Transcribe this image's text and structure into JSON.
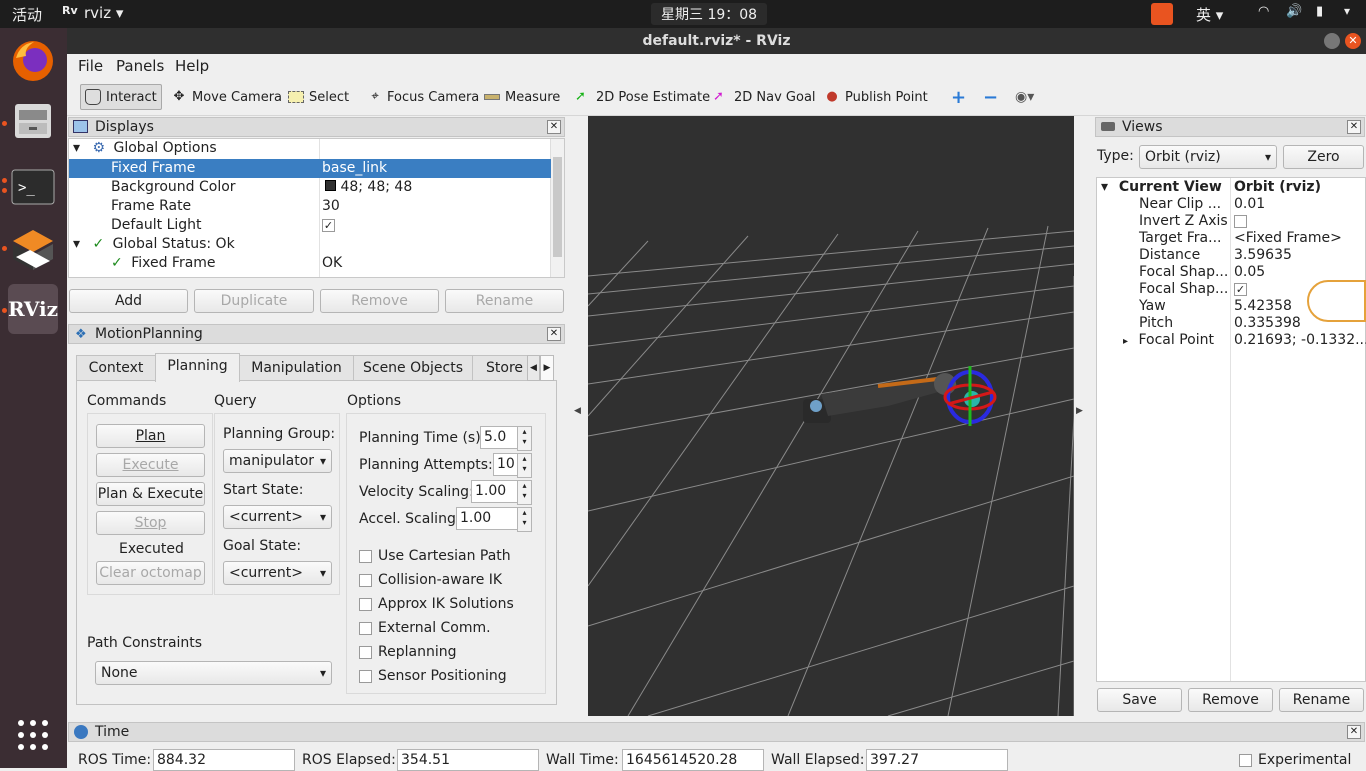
{
  "topbar": {
    "activities": "活动",
    "app_name": "rviz",
    "clock": "星期三 19：08",
    "ime": "英"
  },
  "window": {
    "title": "default.rviz* - RViz"
  },
  "menu": {
    "file": "File",
    "panels": "Panels",
    "help": "Help"
  },
  "toolbar": {
    "interact": "Interact",
    "move_camera": "Move Camera",
    "select": "Select",
    "focus_camera": "Focus Camera",
    "measure": "Measure",
    "pose_estimate": "2D Pose Estimate",
    "nav_goal": "2D Nav Goal",
    "publish_point": "Publish Point"
  },
  "displays": {
    "title": "Displays",
    "global_options": "Global Options",
    "fixed_frame_label": "Fixed Frame",
    "fixed_frame_value": "base_link",
    "bg_color_label": "Background Color",
    "bg_color_value": "48; 48; 48",
    "frame_rate_label": "Frame Rate",
    "frame_rate_value": "30",
    "default_light_label": "Default Light",
    "global_status": "Global Status: Ok",
    "status_fixed_frame": "Fixed Frame",
    "status_fixed_frame_value": "OK",
    "add": "Add",
    "duplicate": "Duplicate",
    "remove": "Remove",
    "rename": "Rename"
  },
  "motion": {
    "title": "MotionPlanning",
    "tabs": [
      "Context",
      "Planning",
      "Manipulation",
      "Scene Objects",
      "Store"
    ],
    "commands": "Commands",
    "query": "Query",
    "options": "Options",
    "plan": "Plan",
    "execute": "Execute",
    "plan_execute": "Plan & Execute",
    "stop": "Stop",
    "executed": "Executed",
    "clear_octomap": "Clear octomap",
    "planning_group_label": "Planning Group:",
    "planning_group": "manipulator",
    "start_state_label": "Start State:",
    "start_state": "<current>",
    "goal_state_label": "Goal State:",
    "goal_state": "<current>",
    "planning_time_label": "Planning Time (s):",
    "planning_time": "5.0",
    "planning_attempts_label": "Planning Attempts:",
    "planning_attempts": "10",
    "velocity_label": "Velocity Scaling:",
    "velocity": "1.00",
    "accel_label": "Accel. Scaling:",
    "accel": "1.00",
    "checks": [
      "Use Cartesian Path",
      "Collision-aware IK",
      "Approx IK Solutions",
      "External Comm.",
      "Replanning",
      "Sensor Positioning"
    ],
    "path_constraints_label": "Path Constraints",
    "path_constraints": "None"
  },
  "views": {
    "title": "Views",
    "type_label": "Type:",
    "type_value": "Orbit (rviz)",
    "zero": "Zero",
    "current_view": "Current View",
    "current_view_value": "Orbit (rviz)",
    "near_clip": "Near Clip ...",
    "near_clip_value": "0.01",
    "invert_z": "Invert Z Axis",
    "target_frame": "Target Fra...",
    "target_frame_value": "<Fixed Frame>",
    "distance": "Distance",
    "distance_value": "3.59635",
    "focal_shape1": "Focal Shap...",
    "focal_shape1_value": "0.05",
    "focal_shape2": "Focal Shap...",
    "yaw": "Yaw",
    "yaw_value": "5.42358",
    "pitch": "Pitch",
    "pitch_value": "0.335398",
    "focal_point": "Focal Point",
    "focal_point_value": "0.21693; -0.1332...",
    "save": "Save",
    "remove": "Remove",
    "rename": "Rename"
  },
  "time": {
    "title": "Time",
    "ros_time_label": "ROS Time:",
    "ros_time": "884.32",
    "ros_elapsed_label": "ROS Elapsed:",
    "ros_elapsed": "354.51",
    "wall_time_label": "Wall Time:",
    "wall_time": "1645614520.28",
    "wall_elapsed_label": "Wall Elapsed:",
    "wall_elapsed": "397.27",
    "experimental": "Experimental"
  },
  "colors": {
    "selection": "#3a7ec2",
    "viewport_bg": "#303030",
    "ubuntu_orange": "#e95420"
  }
}
